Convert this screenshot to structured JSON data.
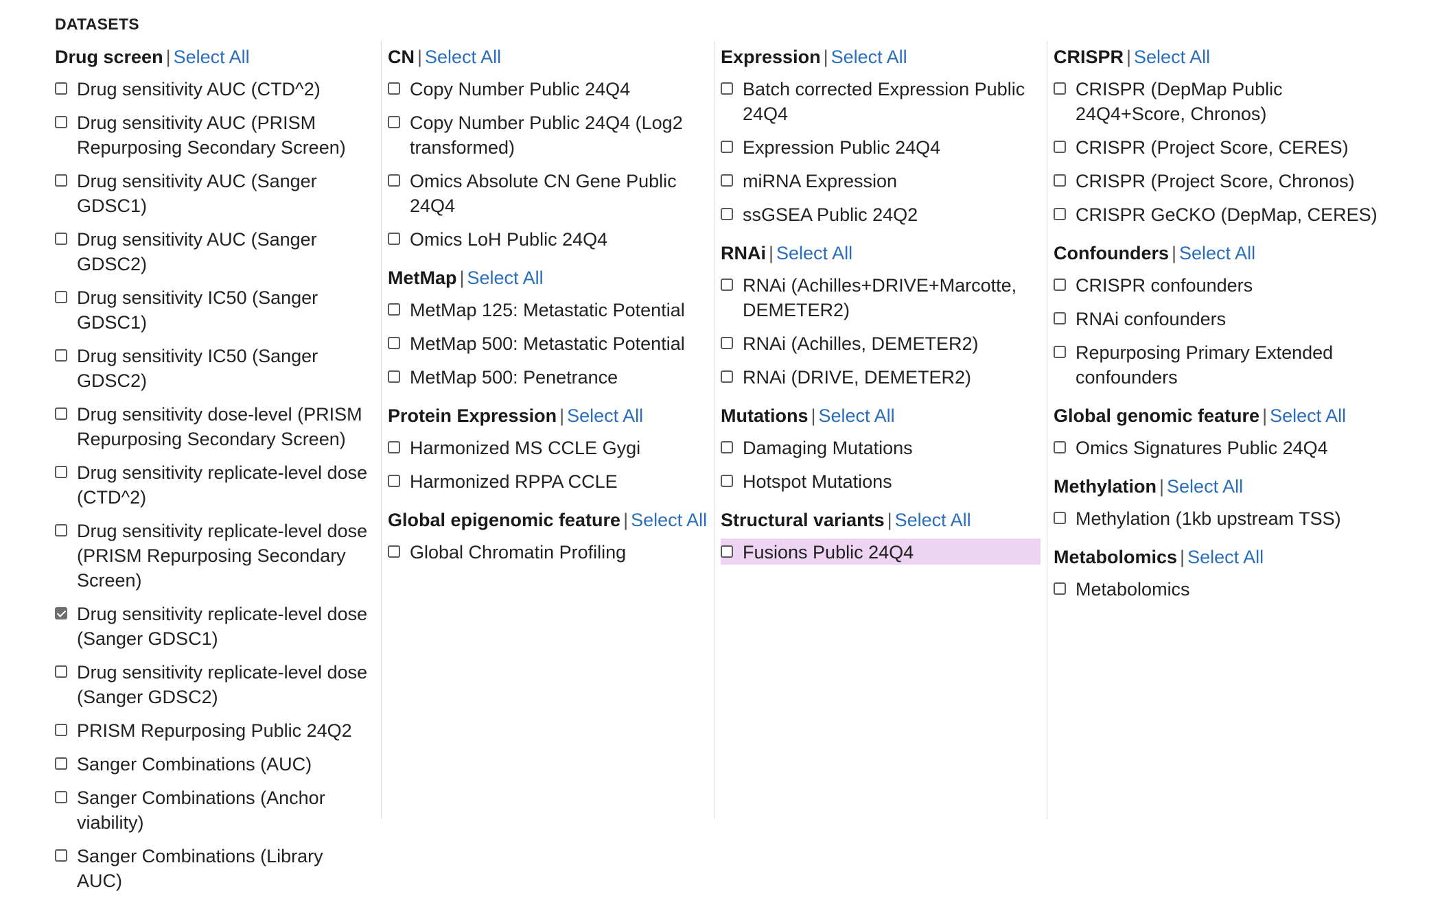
{
  "panel": {
    "title": "DATASETS",
    "select_all_label": "Select All",
    "separator": "|"
  },
  "colors": {
    "link": "#2a6ebb",
    "highlight": "#ecd4f2",
    "divider": "#dcdcdc"
  },
  "columns": [
    {
      "groups": [
        {
          "name": "Drug screen",
          "items": [
            {
              "label": "Drug sensitivity AUC (CTD^2)",
              "checked": false
            },
            {
              "label": "Drug sensitivity AUC (PRISM Repurposing Secondary Screen)",
              "checked": false
            },
            {
              "label": "Drug sensitivity AUC (Sanger GDSC1)",
              "checked": false
            },
            {
              "label": "Drug sensitivity AUC (Sanger GDSC2)",
              "checked": false
            },
            {
              "label": "Drug sensitivity IC50 (Sanger GDSC1)",
              "checked": false
            },
            {
              "label": "Drug sensitivity IC50 (Sanger GDSC2)",
              "checked": false
            },
            {
              "label": "Drug sensitivity dose-level (PRISM Repurposing Secondary Screen)",
              "checked": false
            },
            {
              "label": "Drug sensitivity replicate-level dose (CTD^2)",
              "checked": false
            },
            {
              "label": "Drug sensitivity replicate-level dose (PRISM Repurposing Secondary Screen)",
              "checked": false
            },
            {
              "label": "Drug sensitivity replicate-level dose (Sanger GDSC1)",
              "checked": true
            },
            {
              "label": "Drug sensitivity replicate-level dose (Sanger GDSC2)",
              "checked": false
            },
            {
              "label": "PRISM Repurposing Public 24Q2",
              "checked": false
            },
            {
              "label": "Sanger Combinations (AUC)",
              "checked": false
            },
            {
              "label": "Sanger Combinations (Anchor viability)",
              "checked": false
            },
            {
              "label": "Sanger Combinations (Library AUC)",
              "checked": false
            }
          ]
        }
      ]
    },
    {
      "groups": [
        {
          "name": "CN",
          "items": [
            {
              "label": "Copy Number Public 24Q4",
              "checked": false
            },
            {
              "label": "Copy Number Public 24Q4 (Log2 transformed)",
              "checked": false
            },
            {
              "label": "Omics Absolute CN Gene Public 24Q4",
              "checked": false
            },
            {
              "label": "Omics LoH Public 24Q4",
              "checked": false
            }
          ]
        },
        {
          "name": "MetMap",
          "items": [
            {
              "label": "MetMap 125: Metastatic Potential",
              "checked": false
            },
            {
              "label": "MetMap 500: Metastatic Potential",
              "checked": false
            },
            {
              "label": "MetMap 500: Penetrance",
              "checked": false
            }
          ]
        },
        {
          "name": "Protein Expression",
          "items": [
            {
              "label": "Harmonized MS CCLE Gygi",
              "checked": false
            },
            {
              "label": "Harmonized RPPA CCLE",
              "checked": false
            }
          ]
        },
        {
          "name": "Global epigenomic feature",
          "items": [
            {
              "label": "Global Chromatin Profiling",
              "checked": false
            }
          ]
        }
      ]
    },
    {
      "groups": [
        {
          "name": "Expression",
          "items": [
            {
              "label": "Batch corrected Expression Public 24Q4",
              "checked": false
            },
            {
              "label": "Expression Public 24Q4",
              "checked": false
            },
            {
              "label": "miRNA Expression",
              "checked": false
            },
            {
              "label": "ssGSEA Public 24Q2",
              "checked": false
            }
          ]
        },
        {
          "name": "RNAi",
          "items": [
            {
              "label": "RNAi (Achilles+DRIVE+Marcotte, DEMETER2)",
              "checked": false
            },
            {
              "label": "RNAi (Achilles, DEMETER2)",
              "checked": false
            },
            {
              "label": "RNAi (DRIVE, DEMETER2)",
              "checked": false
            }
          ]
        },
        {
          "name": "Mutations",
          "items": [
            {
              "label": "Damaging Mutations",
              "checked": false
            },
            {
              "label": "Hotspot Mutations",
              "checked": false
            }
          ]
        },
        {
          "name": "Structural variants",
          "items": [
            {
              "label": "Fusions Public 24Q4",
              "checked": false,
              "highlighted": true
            }
          ]
        }
      ]
    },
    {
      "groups": [
        {
          "name": "CRISPR",
          "items": [
            {
              "label": "CRISPR (DepMap Public 24Q4+Score, Chronos)",
              "checked": false
            },
            {
              "label": "CRISPR (Project Score, CERES)",
              "checked": false
            },
            {
              "label": "CRISPR (Project Score, Chronos)",
              "checked": false
            },
            {
              "label": "CRISPR GeCKO (DepMap, CERES)",
              "checked": false
            }
          ]
        },
        {
          "name": "Confounders",
          "items": [
            {
              "label": "CRISPR confounders",
              "checked": false
            },
            {
              "label": "RNAi confounders",
              "checked": false
            },
            {
              "label": "Repurposing Primary Extended confounders",
              "checked": false
            }
          ]
        },
        {
          "name": "Global genomic feature",
          "items": [
            {
              "label": "Omics Signatures Public 24Q4",
              "checked": false
            }
          ]
        },
        {
          "name": "Methylation",
          "items": [
            {
              "label": "Methylation (1kb upstream TSS)",
              "checked": false
            }
          ]
        },
        {
          "name": "Metabolomics",
          "items": [
            {
              "label": "Metabolomics",
              "checked": false
            }
          ]
        }
      ]
    }
  ]
}
